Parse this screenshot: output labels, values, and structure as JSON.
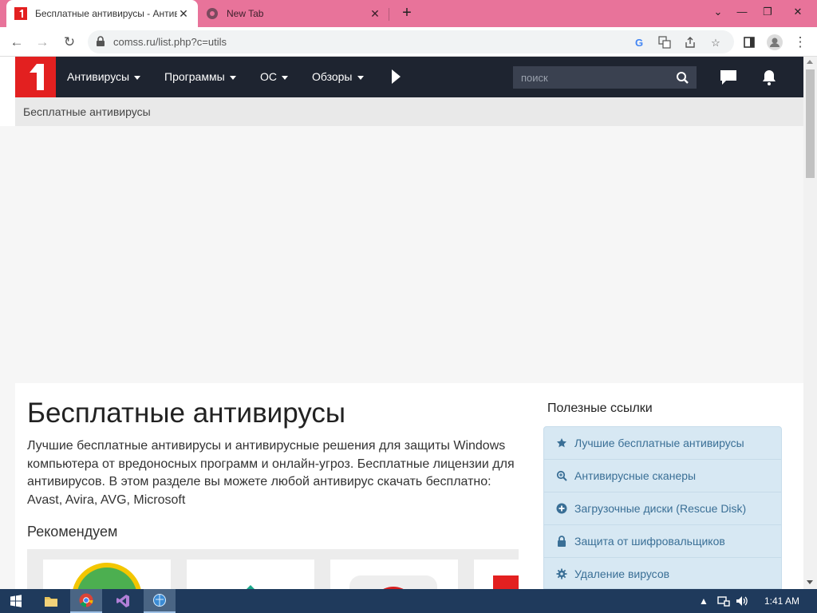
{
  "browser": {
    "tabs": [
      {
        "title": "Бесплатные антивирусы - Антивирусы",
        "active": true
      },
      {
        "title": "New Tab",
        "active": false
      }
    ],
    "address": {
      "url": "comss.ru/list.php?c=utils"
    }
  },
  "site": {
    "nav": [
      {
        "label": "Антивирусы"
      },
      {
        "label": "Программы"
      },
      {
        "label": "ОС"
      },
      {
        "label": "Обзоры"
      }
    ],
    "search": {
      "placeholder": "поиск"
    },
    "breadcrumb": "Бесплатные антивирусы"
  },
  "main": {
    "title": "Бесплатные антивирусы",
    "intro": "Лучшие бесплатные антивирусы и антивирусные решения для защиты Windows компьютера от вредоносных программ и онлайн-угроз. Бесплатные лицензии для антивирусов. В этом разделе вы можете любой антивирус скачать бесплатно: Avast, Avira, AVG, Microsoft",
    "recommended_title": "Рекомендуем"
  },
  "sidebar": {
    "title": "Полезные ссылки",
    "links": [
      {
        "label": "Лучшие бесплатные антивирусы",
        "icon": "star-icon"
      },
      {
        "label": "Антивирусные сканеры",
        "icon": "zoom-icon"
      },
      {
        "label": "Загрузочные диски (Rescue Disk)",
        "icon": "plus-circle-icon"
      },
      {
        "label": "Защита от шифровальщиков",
        "icon": "lock-icon"
      },
      {
        "label": "Удаление вирусов",
        "icon": "gear-icon"
      }
    ]
  },
  "taskbar": {
    "time": "1:41 AM"
  },
  "colors": {
    "tabbar": "#e8739a",
    "header": "#1e2430",
    "logo": "#e32020",
    "sidebar": "#d7e8f3",
    "link": "#3a6f96"
  }
}
